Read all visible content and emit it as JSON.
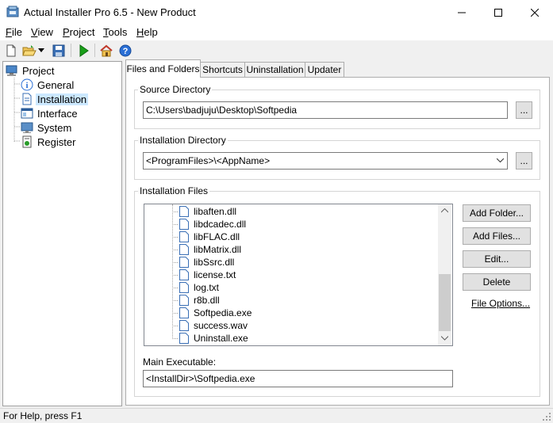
{
  "window": {
    "title": "Actual Installer Pro 6.5 - New Product",
    "minimize_glyph": "—",
    "maximize_glyph": "☐",
    "close_glyph": "✕"
  },
  "menu": [
    {
      "label": "File",
      "u": "F",
      "rest": "ile"
    },
    {
      "label": "View",
      "u": "V",
      "rest": "iew"
    },
    {
      "label": "Project",
      "u": "P",
      "rest": "roject"
    },
    {
      "label": "Tools",
      "u": "T",
      "rest": "ools"
    },
    {
      "label": "Help",
      "u": "H",
      "rest": "elp"
    }
  ],
  "toolbar": {
    "icons": [
      "new-icon",
      "open-icon",
      "dropdown-arrow-icon",
      "save-icon",
      "build-run-icon",
      "home-icon",
      "help-icon"
    ]
  },
  "tree": {
    "root": "Project",
    "items": [
      "General",
      "Installation",
      "Interface",
      "System",
      "Register"
    ],
    "selected": "Installation"
  },
  "tabs": [
    "Files and Folders",
    "Shortcuts",
    "Uninstallation",
    "Updater"
  ],
  "active_tab": "Files and Folders",
  "source": {
    "label": "Source Directory",
    "value": "C:\\Users\\badjuju\\Desktop\\Softpedia",
    "browse": "..."
  },
  "install_dir": {
    "label": "Installation Directory",
    "value": "<ProgramFiles>\\<AppName>",
    "browse": "..."
  },
  "install_files": {
    "label": "Installation Files",
    "files": [
      "libaften.dll",
      "libdcadec.dll",
      "libFLAC.dll",
      "libMatrix.dll",
      "libSsrc.dll",
      "license.txt",
      "log.txt",
      "r8b.dll",
      "Softpedia.exe",
      "success.wav",
      "Uninstall.exe"
    ],
    "add_folder": "Add Folder...",
    "add_files": "Add Files...",
    "edit": "Edit...",
    "delete": "Delete",
    "file_options": "File Options..."
  },
  "main_exe": {
    "label": "Main Executable:",
    "value": "<InstallDir>\\Softpedia.exe"
  },
  "status": "For Help, press F1",
  "colors": {
    "selection": "#cce8ff",
    "tree_selected_text": "#000000",
    "run_green": "#1aa01a"
  }
}
